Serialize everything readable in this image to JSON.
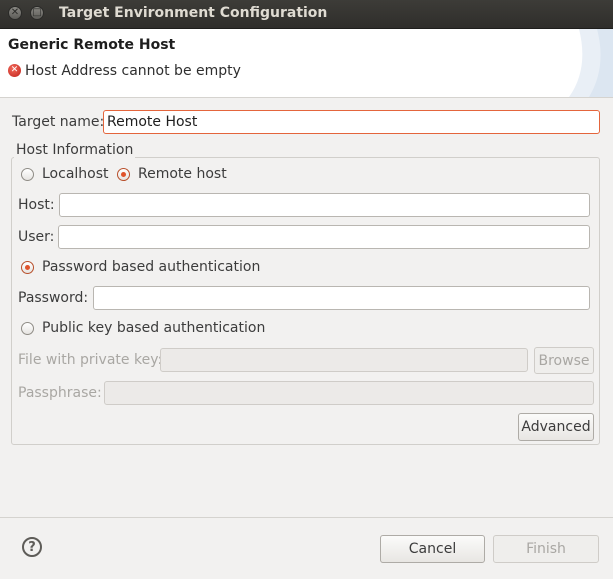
{
  "window": {
    "title": "Target Environment Configuration"
  },
  "header": {
    "title": "Generic Remote Host",
    "error_message": "Host Address cannot be empty"
  },
  "form": {
    "target_name": {
      "label": "Target name:",
      "value": "Remote Host"
    },
    "host_information": {
      "legend": "Host Information",
      "localhost_label": "Localhost",
      "remote_host_label": "Remote host",
      "selected_host_type": "Remote host",
      "host": {
        "label": "Host:",
        "value": ""
      },
      "user": {
        "label": "User:",
        "value": ""
      },
      "password_auth_label": "Password based authentication",
      "selected_auth": "Password based authentication",
      "password": {
        "label": "Password:",
        "value": ""
      },
      "public_key_auth_label": "Public key based authentication",
      "private_key_file": {
        "label": "File with private key:",
        "value": ""
      },
      "browse_label": "Browse",
      "passphrase": {
        "label": "Passphrase:",
        "value": ""
      },
      "advanced_label": "Advanced"
    }
  },
  "footer": {
    "cancel_label": "Cancel",
    "finish_label": "Finish"
  },
  "icons": {
    "help": "question-mark-icon",
    "error": "error-icon",
    "close": "close-icon",
    "maximize": "maximize-icon"
  },
  "colors": {
    "accent": "#e0532b",
    "focus_border": "#e4653c",
    "error": "#c0211b",
    "titlebar": "#3d3c38"
  }
}
